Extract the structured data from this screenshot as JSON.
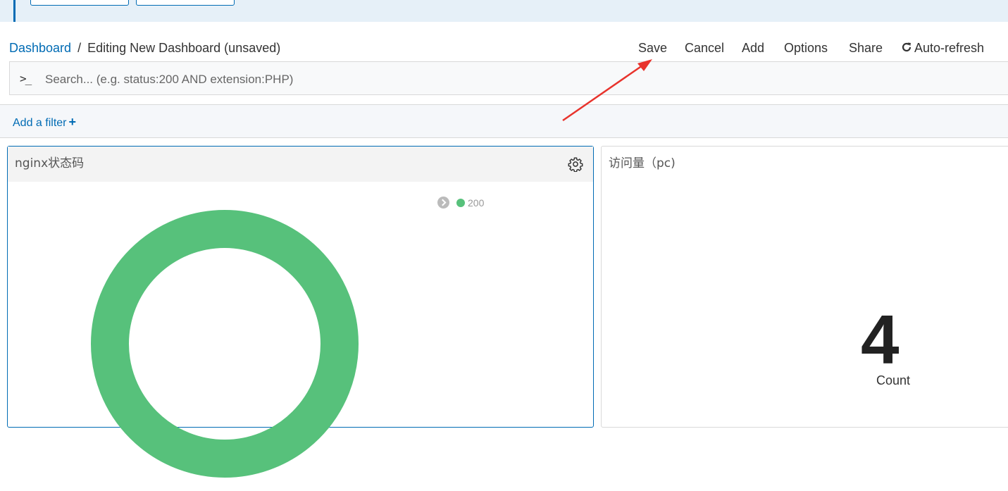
{
  "breadcrumb": {
    "root": "Dashboard",
    "separator": "/",
    "current": "Editing New Dashboard (unsaved)"
  },
  "menu": {
    "save": "Save",
    "cancel": "Cancel",
    "add": "Add",
    "options": "Options",
    "share": "Share",
    "auto_refresh": "Auto-refresh"
  },
  "search": {
    "prompt": ">_",
    "placeholder": "Search... (e.g. status:200 AND extension:PHP)"
  },
  "filters": {
    "add_label": "Add a filter",
    "add_icon": "+"
  },
  "panels": {
    "status_codes": {
      "title": "nginx状态码",
      "legend": [
        {
          "label": "200",
          "color": "#57c17b"
        }
      ],
      "donut_color": "#57c17b"
    },
    "visits": {
      "title": "访问量（pc)",
      "metric_value": "4",
      "metric_label": "Count"
    }
  },
  "colors": {
    "accent": "#006bb4",
    "annotation_arrow": "#e8332c"
  }
}
